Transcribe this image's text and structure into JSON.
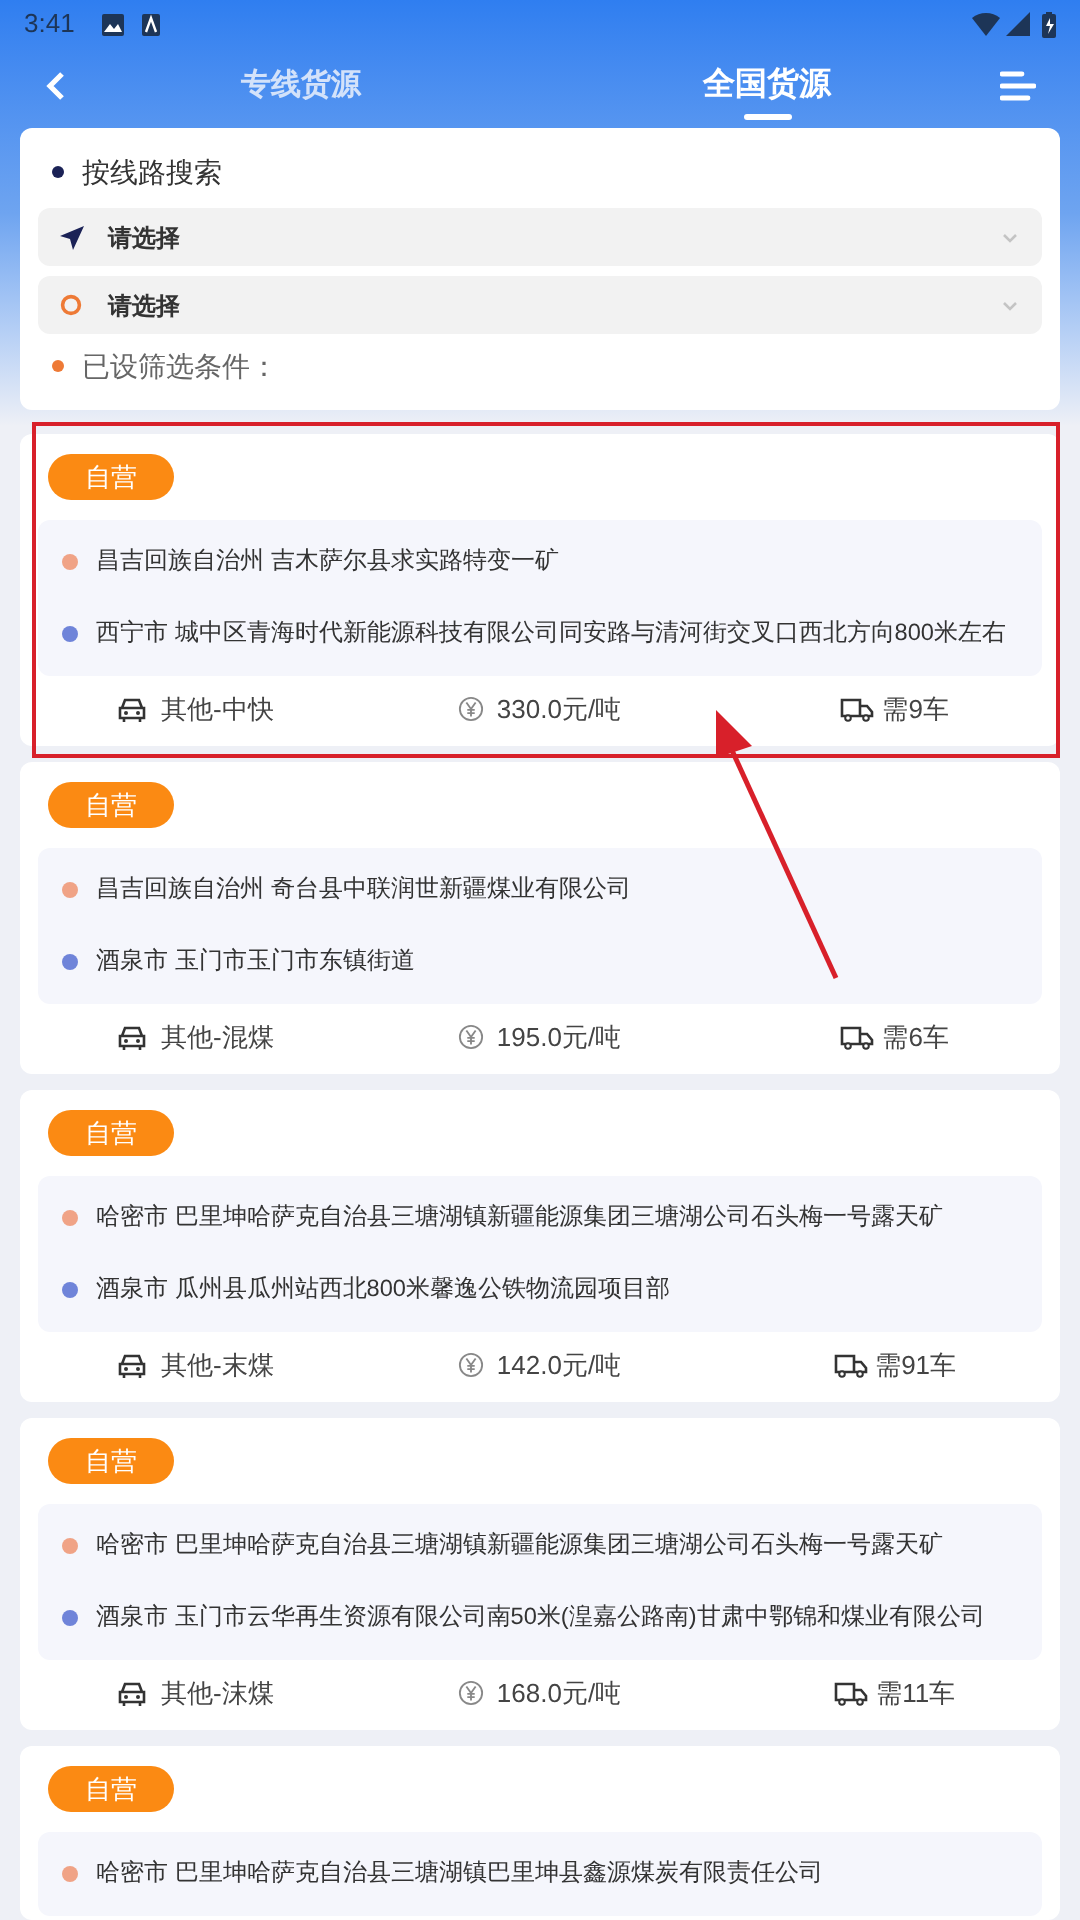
{
  "status_bar": {
    "time": "3:41"
  },
  "tabs": [
    {
      "label": "专线货源",
      "selected": false
    },
    {
      "label": "全国货源",
      "selected": true
    }
  ],
  "search": {
    "title": "按线路搜索",
    "origin": {
      "placeholder": "请选择"
    },
    "destination": {
      "placeholder": "请选择"
    },
    "filters_label": "已设筛选条件："
  },
  "cards": [
    {
      "badge": "自营",
      "highlighted": true,
      "from": "昌吉回族自治州 吉木萨尔县求实路特变一矿",
      "to": "西宁市 城中区青海时代新能源科技有限公司同安路与清河街交叉口西北方向800米左右",
      "cargo": "其他-中快",
      "price": "330.0元/吨",
      "trucks": "需9车"
    },
    {
      "badge": "自营",
      "highlighted": false,
      "from": "昌吉回族自治州 奇台县中联润世新疆煤业有限公司",
      "to": "酒泉市 玉门市玉门市东镇街道",
      "cargo": "其他-混煤",
      "price": "195.0元/吨",
      "trucks": "需6车"
    },
    {
      "badge": "自营",
      "highlighted": false,
      "from": "哈密市 巴里坤哈萨克自治县三塘湖镇新疆能源集团三塘湖公司石头梅一号露天矿",
      "to": "酒泉市 瓜州县瓜州站西北800米馨逸公铁物流园项目部",
      "cargo": "其他-末煤",
      "price": "142.0元/吨",
      "trucks": "需91车"
    },
    {
      "badge": "自营",
      "highlighted": false,
      "from": "哈密市 巴里坤哈萨克自治县三塘湖镇新疆能源集团三塘湖公司石头梅一号露天矿",
      "to": "酒泉市 玉门市云华再生资源有限公司南50米(湟嘉公路南)甘肃中鄂锦和煤业有限公司",
      "cargo": "其他-沫煤",
      "price": "168.0元/吨",
      "trucks": "需11车"
    },
    {
      "badge": "自营",
      "highlighted": false,
      "from": "哈密市 巴里坤哈萨克自治县三塘湖镇巴里坤县鑫源煤炭有限责任公司"
    }
  ]
}
